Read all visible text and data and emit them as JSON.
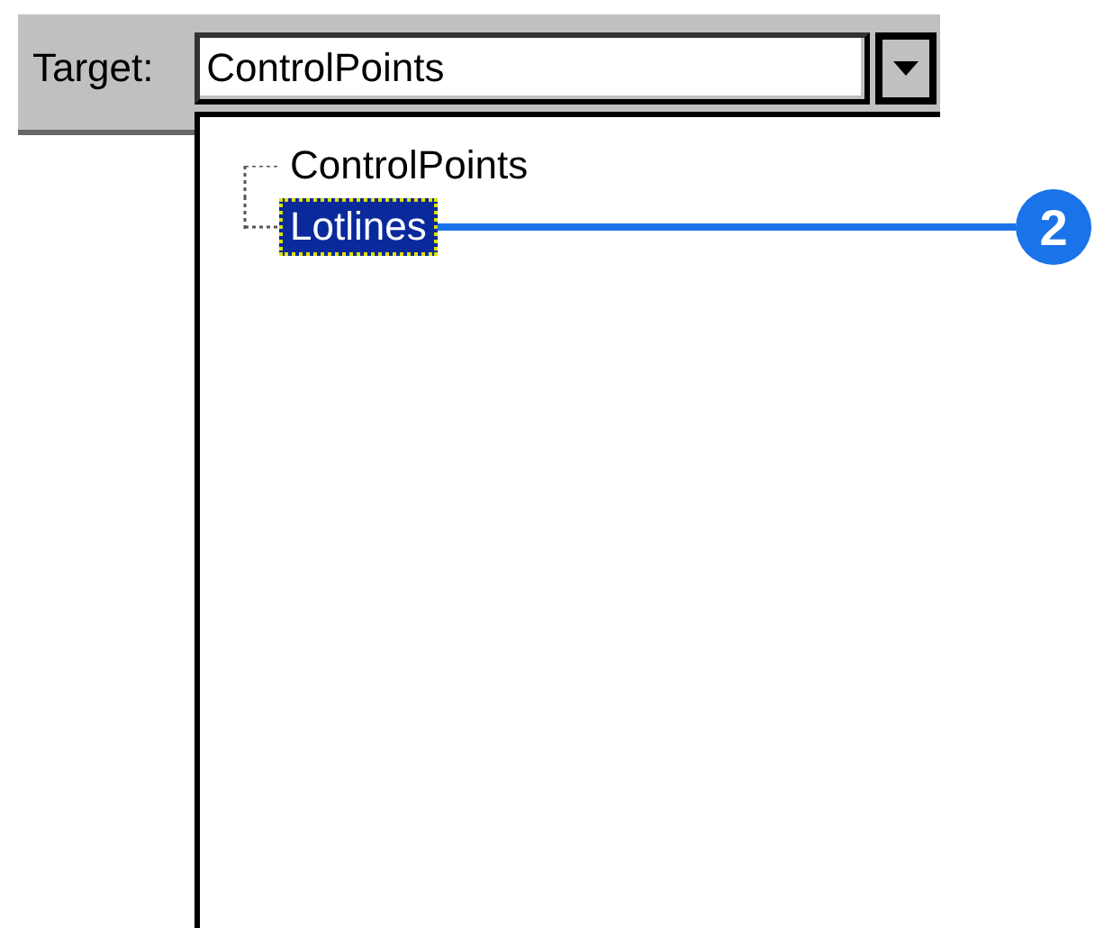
{
  "target": {
    "label": "Target:",
    "value": "ControlPoints"
  },
  "tree": {
    "items": [
      {
        "label": "ControlPoints",
        "selected": false
      },
      {
        "label": "Lotlines",
        "selected": true
      }
    ]
  },
  "callout": {
    "number": "2"
  }
}
